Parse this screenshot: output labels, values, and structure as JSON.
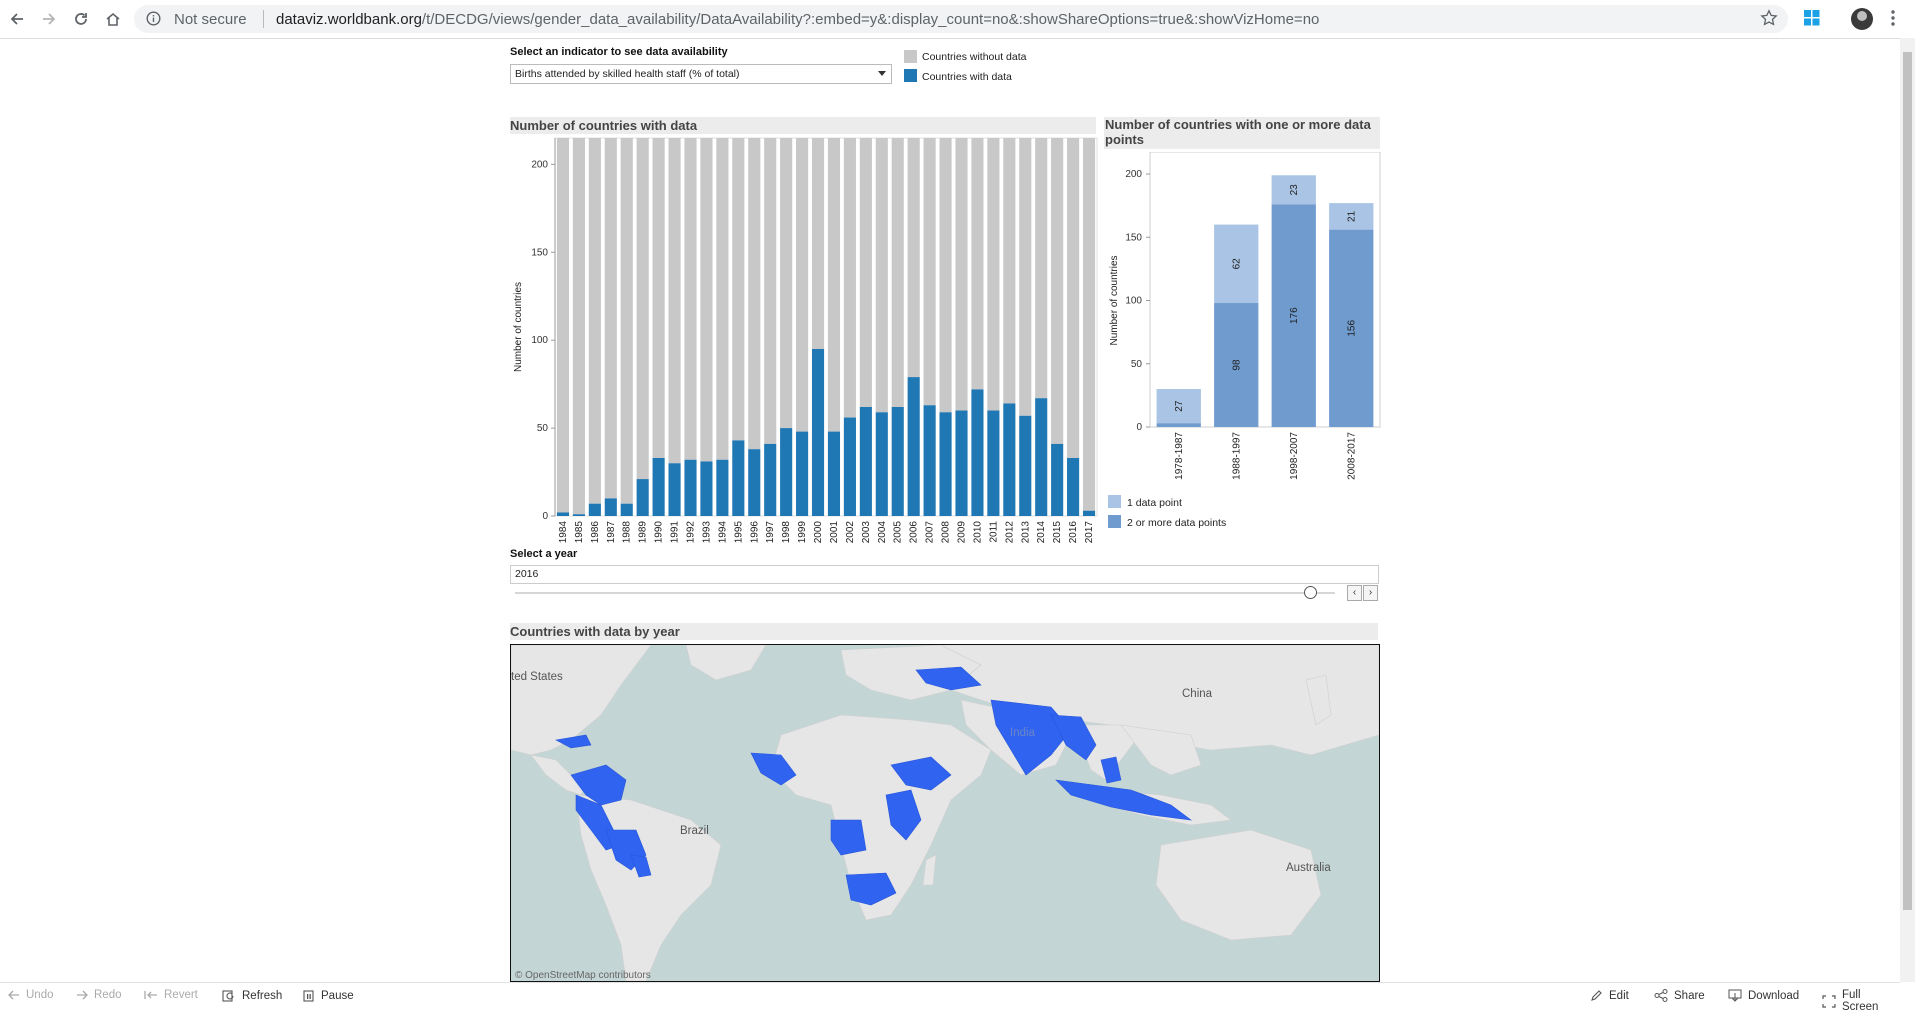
{
  "browser": {
    "security_label": "Not secure",
    "url_host": "dataviz.worldbank.org",
    "url_path": "/t/DECDG/views/gender_data_availability/DataAvailability?:embed=y&:display_count=no&:showShareOptions=true&:showVizHome=no"
  },
  "indicator": {
    "label": "Select an indicator to see data availability",
    "selected": "Births attended by skilled health staff (% of total)"
  },
  "legend_top": {
    "without": "Countries without data",
    "with": "Countries with data",
    "color_without": "#c8c8c8",
    "color_with": "#1f77b4"
  },
  "main_chart": {
    "title": "Number of countries with data",
    "ylabel": "Number of countries"
  },
  "side_chart": {
    "title_line1": "Number of countries with one or more data",
    "title_line2": "points",
    "ylabel": "Number of countries",
    "legend_one": "1 data point",
    "legend_two": "2 or more data points",
    "color_one": "#a9c4e4",
    "color_two": "#6f9bce"
  },
  "year_select": {
    "label": "Select a year",
    "value": "2016"
  },
  "map": {
    "title": "Countries with data by year",
    "labels": {
      "us": "ted States",
      "china": "China",
      "india": "India",
      "brazil": "Brazil",
      "australia": "Australia"
    },
    "credit": "© OpenStreetMap contributors",
    "highlight_color": "#2f63f0"
  },
  "toolbar": {
    "undo": "Undo",
    "redo": "Redo",
    "revert": "Revert",
    "refresh": "Refresh",
    "pause": "Pause",
    "edit": "Edit",
    "share": "Share",
    "download": "Download",
    "fullscreen": "Full Screen"
  },
  "chart_data": [
    {
      "type": "bar",
      "title": "Number of countries with data",
      "ylabel": "Number of countries",
      "ylim": [
        0,
        215
      ],
      "yticks": [
        0,
        50,
        100,
        150,
        200
      ],
      "categories": [
        "1984",
        "1985",
        "1986",
        "1987",
        "1988",
        "1989",
        "1990",
        "1991",
        "1992",
        "1993",
        "1994",
        "1995",
        "1996",
        "1997",
        "1998",
        "1999",
        "2000",
        "2001",
        "2002",
        "2003",
        "2004",
        "2005",
        "2006",
        "2007",
        "2008",
        "2009",
        "2010",
        "2011",
        "2012",
        "2013",
        "2014",
        "2015",
        "2016",
        "2017"
      ],
      "series": [
        {
          "name": "Countries with data",
          "values": [
            2,
            1,
            7,
            10,
            7,
            21,
            33,
            30,
            32,
            31,
            32,
            43,
            38,
            41,
            50,
            48,
            95,
            48,
            56,
            62,
            59,
            62,
            79,
            63,
            59,
            60,
            72,
            60,
            64,
            57,
            67,
            41,
            33,
            3
          ]
        },
        {
          "name": "Countries without data",
          "values": [
            213,
            214,
            208,
            205,
            208,
            194,
            182,
            185,
            183,
            184,
            183,
            172,
            177,
            174,
            165,
            167,
            120,
            167,
            159,
            153,
            156,
            153,
            136,
            152,
            156,
            155,
            143,
            155,
            151,
            158,
            148,
            174,
            182,
            212
          ]
        }
      ],
      "grid": false
    },
    {
      "type": "bar",
      "title": "Number of countries with one or more data points",
      "ylabel": "Number of countries",
      "ylim": [
        0,
        200
      ],
      "yticks": [
        0,
        50,
        100,
        150,
        200
      ],
      "categories": [
        "1978-1987",
        "1988-1997",
        "1998-2007",
        "2008-2017"
      ],
      "series": [
        {
          "name": "2 or more data points",
          "values": [
            3,
            98,
            176,
            156
          ]
        },
        {
          "name": "1 data point",
          "values": [
            27,
            62,
            23,
            21
          ]
        }
      ],
      "stacked": true
    }
  ]
}
